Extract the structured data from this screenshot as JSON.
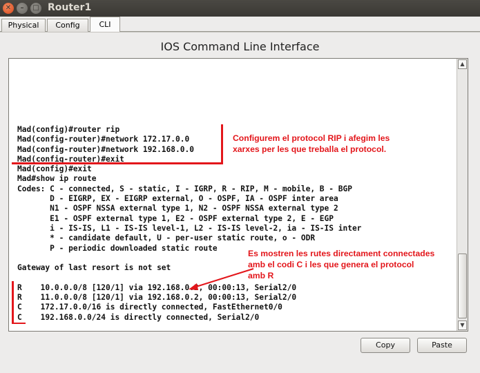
{
  "window": {
    "title": "Router1"
  },
  "tabs": [
    {
      "label": "Physical"
    },
    {
      "label": "Config"
    },
    {
      "label": "CLI"
    }
  ],
  "cli": {
    "heading": "IOS Command Line Interface",
    "lines": [
      "Mad(config)#router rip",
      "Mad(config-router)#network 172.17.0.0",
      "Mad(config-router)#network 192.168.0.0",
      "Mad(config-router)#exit",
      "Mad(config)#exit",
      "Mad#show ip route",
      "Codes: C - connected, S - static, I - IGRP, R - RIP, M - mobile, B - BGP",
      "       D - EIGRP, EX - EIGRP external, O - OSPF, IA - OSPF inter area",
      "       N1 - OSPF NSSA external type 1, N2 - OSPF NSSA external type 2",
      "       E1 - OSPF external type 1, E2 - OSPF external type 2, E - EGP",
      "       i - IS-IS, L1 - IS-IS level-1, L2 - IS-IS level-2, ia - IS-IS inter",
      "       * - candidate default, U - per-user static route, o - ODR",
      "       P - periodic downloaded static route",
      "",
      "Gateway of last resort is not set",
      "",
      "R    10.0.0.0/8 [120/1] via 192.168.0.2, 00:00:13, Serial2/0",
      "R    11.0.0.0/8 [120/1] via 192.168.0.2, 00:00:13, Serial2/0",
      "C    172.17.0.0/16 is directly connected, FastEthernet0/0",
      "C    192.168.0.0/24 is directly connected, Serial2/0"
    ]
  },
  "annotations": {
    "note1": "Configurem el protocol RIP i afegim les\nxarxes per les que treballa el protocol.",
    "note2": "Es mostren les rutes directament connectades\namb el codi C i les que genera el protocol\namb R",
    "color": "#e3161b"
  },
  "buttons": {
    "copy": "Copy",
    "paste": "Paste"
  }
}
